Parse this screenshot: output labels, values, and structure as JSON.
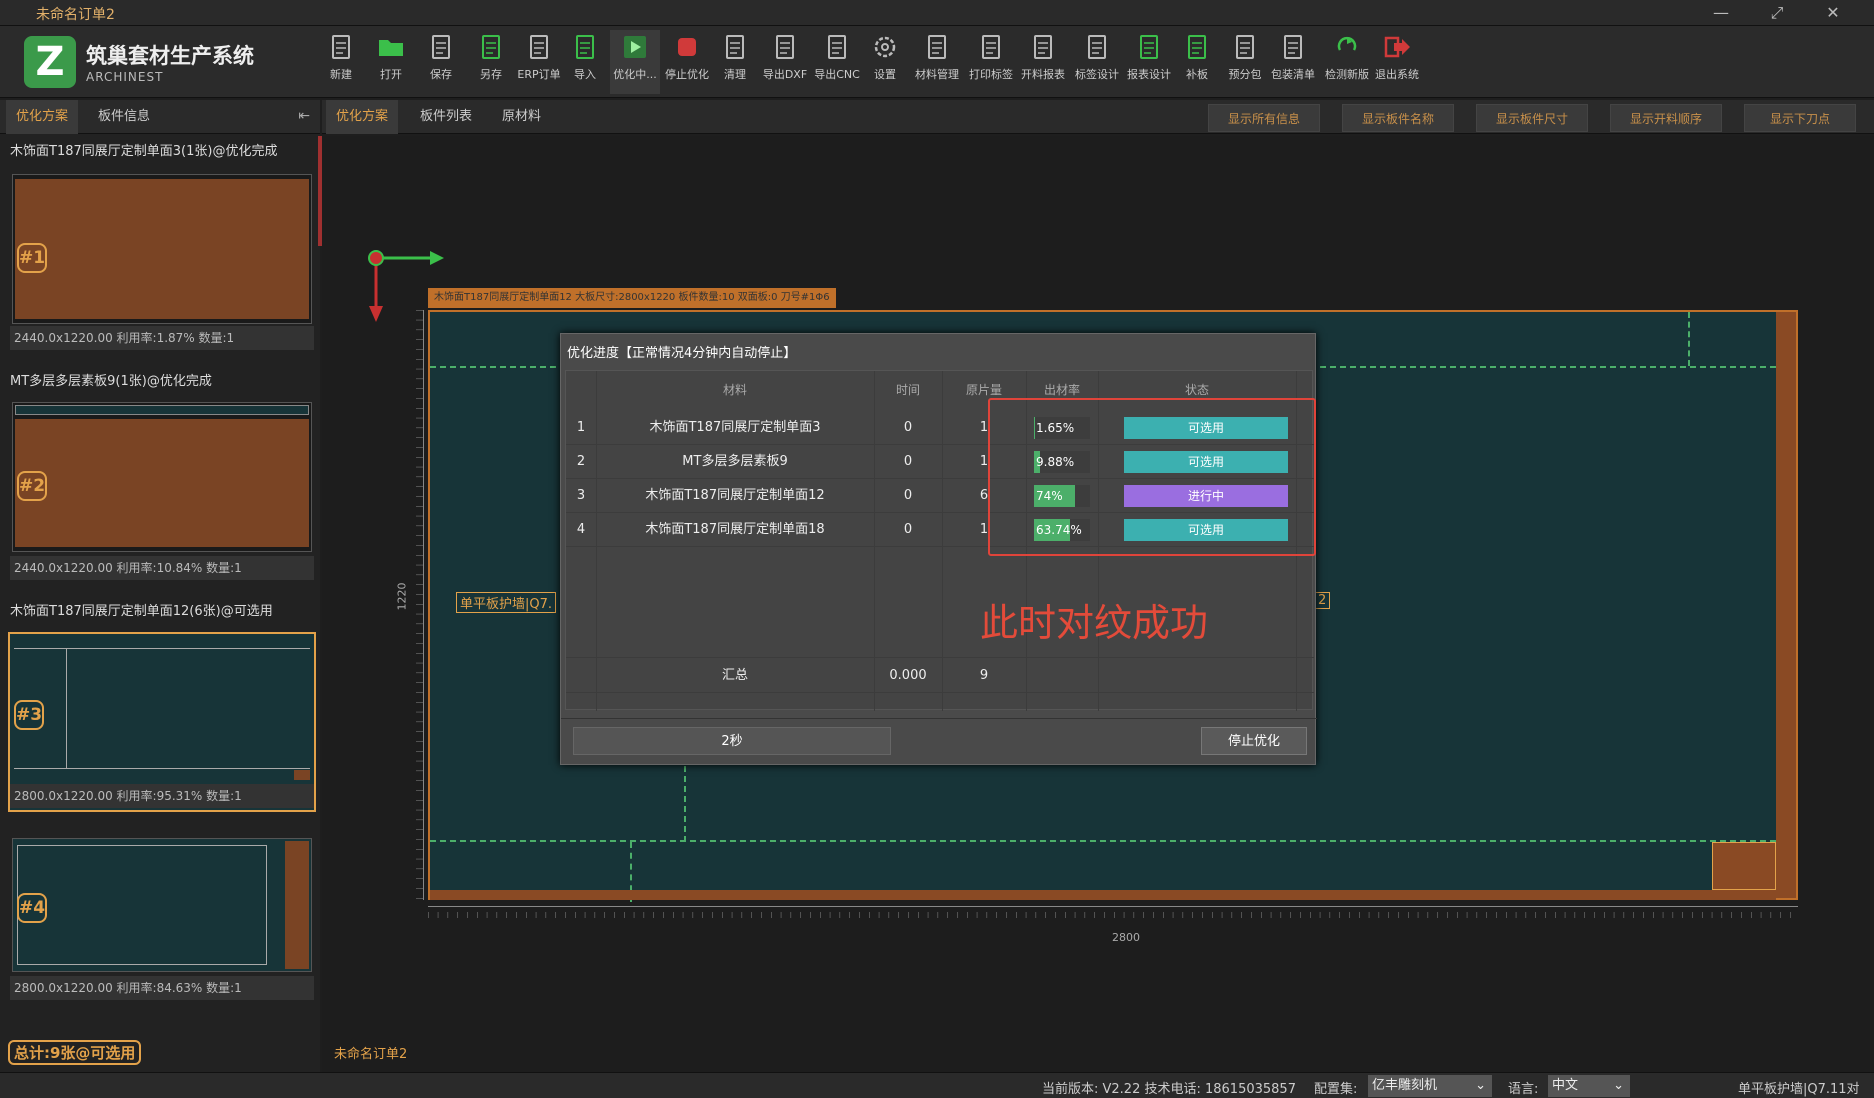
{
  "window": {
    "title": "未命名订单2"
  },
  "app": {
    "logo_letter": "Z",
    "name": "筑巢套材生产系统",
    "subtitle": "ARCHINEST"
  },
  "toolbar": [
    {
      "label": "新建",
      "icon": "new-file-icon"
    },
    {
      "label": "打开",
      "icon": "folder-open-icon"
    },
    {
      "label": "保存",
      "icon": "save-icon"
    },
    {
      "label": "另存",
      "icon": "save-as-icon"
    },
    {
      "label": "ERP订单",
      "icon": "erp-order-icon"
    },
    {
      "label": "导入",
      "icon": "import-xml-icon"
    },
    {
      "label": "优化中...",
      "icon": "play-icon"
    },
    {
      "label": "停止优化",
      "icon": "stop-icon"
    },
    {
      "label": "清理",
      "icon": "broom-icon"
    },
    {
      "label": "导出DXF",
      "icon": "export-dxf-icon"
    },
    {
      "label": "导出CNC",
      "icon": "export-cnc-icon"
    },
    {
      "label": "设置",
      "icon": "gear-icon"
    },
    {
      "label": "材料管理",
      "icon": "layers-icon"
    },
    {
      "label": "打印标签",
      "icon": "printer-icon"
    },
    {
      "label": "开料报表",
      "icon": "report-icon"
    },
    {
      "label": "标签设计",
      "icon": "barcode-icon"
    },
    {
      "label": "报表设计",
      "icon": "report-design-icon"
    },
    {
      "label": "补板",
      "icon": "patch-board-icon"
    },
    {
      "label": "预分包",
      "icon": "pre-package-icon"
    },
    {
      "label": "包装清单",
      "icon": "package-list-icon"
    },
    {
      "label": "检测新版",
      "icon": "update-icon"
    },
    {
      "label": "退出系统",
      "icon": "exit-icon"
    }
  ],
  "left_panel": {
    "tabs": [
      "优化方案",
      "板件信息"
    ],
    "boards": [
      {
        "title": "木饰面T187同展厅定制单面3(1张)@优化完成",
        "badge": "#1",
        "info": "2440.0x1220.00 利用率:1.87% 数量:1"
      },
      {
        "title": "MT多层多层素板9(1张)@优化完成",
        "badge": "#2",
        "info": "2440.0x1220.00 利用率:10.84% 数量:1"
      },
      {
        "title": "木饰面T187同展厅定制单面12(6张)@可选用",
        "badge": "#3",
        "info": "2800.0x1220.00 利用率:95.31% 数量:1"
      },
      {
        "title": "",
        "badge": "#4",
        "info": "2800.0x1220.00 利用率:84.63% 数量:1"
      }
    ],
    "total": "总计:9张@可选用"
  },
  "right_panel": {
    "tabs": [
      "优化方案",
      "板件列表",
      "原材料"
    ],
    "buttons": [
      "显示所有信息",
      "显示板件名称",
      "显示板件尺寸",
      "显示开料顺序",
      "显示下刀点"
    ],
    "board_caption": "木饰面T187同展厅定制单面12 大板尺寸:2800x1220 板件数量:10 双面板:0 刀号#1Φ6",
    "panel_label_left": "单平板护墙|Q7.",
    "panel_label_right": "2",
    "ruler_h_label": "2800",
    "ruler_v_label": "1220",
    "doc_name": "未命名订单2"
  },
  "dialog": {
    "title": "优化进度【正常情况4分钟内自动停止】",
    "headers": [
      "材料",
      "时间",
      "原片量",
      "出材率",
      "状态"
    ],
    "rows": [
      {
        "no": "1",
        "material": "木饰面T187同展厅定制单面3",
        "time": "0",
        "count": "1",
        "rate_text": "1.65%",
        "rate": 1.65,
        "status": "可选用",
        "status_color": "#3cb0b0"
      },
      {
        "no": "2",
        "material": "MT多层多层素板9",
        "time": "0",
        "count": "1",
        "rate_text": "9.88%",
        "rate": 9.88,
        "status": "可选用",
        "status_color": "#3cb0b0"
      },
      {
        "no": "3",
        "material": "木饰面T187同展厅定制单面12",
        "time": "0",
        "count": "6",
        "rate_text": "74%",
        "rate": 74,
        "status": "进行中",
        "status_color": "#9a6ee0"
      },
      {
        "no": "4",
        "material": "木饰面T187同展厅定制单面18",
        "time": "0",
        "count": "1",
        "rate_text": "63.74%",
        "rate": 63.74,
        "status": "可选用",
        "status_color": "#3cb0b0"
      }
    ],
    "summary": {
      "label": "汇总",
      "time": "0.000",
      "count": "9"
    },
    "timer": "2秒",
    "stop_button": "停止优化"
  },
  "annotation": "此时对纹成功",
  "statusbar": {
    "version_text": "当前版本: V2.22 技术电话: 18615035857",
    "config_label": "配置集:",
    "config_value": "亿丰雕刻机",
    "lang_label": "语言:",
    "lang_value": "中文",
    "right_text": "单平板护墙|Q7.11对"
  },
  "colors": {
    "accent": "#e3a24a",
    "board_fill": "#173438",
    "board_edge": "#c0702a",
    "annotation": "#e34b3a"
  }
}
